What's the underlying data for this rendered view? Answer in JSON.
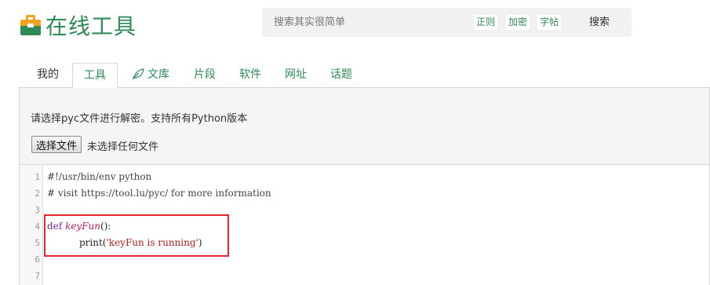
{
  "header": {
    "logo_text": "在线工具",
    "search_placeholder": "搜索其实很简单",
    "quick_links": [
      "正则",
      "加密",
      "字帖"
    ],
    "search_button": "搜索"
  },
  "tabs": [
    {
      "label": "我的",
      "active": false
    },
    {
      "label": "工具",
      "active": true
    },
    {
      "label": "文库",
      "active": false,
      "icon": "leaf-icon"
    },
    {
      "label": "片段",
      "active": false
    },
    {
      "label": "软件",
      "active": false
    },
    {
      "label": "网址",
      "active": false
    },
    {
      "label": "话题",
      "active": false
    }
  ],
  "panel": {
    "description": "请选择pyc文件进行解密。支持所有Python版本",
    "file_button": "选择文件",
    "file_status": "未选择任何文件"
  },
  "editor": {
    "line_numbers": [
      "1",
      "2",
      "3",
      "4",
      "5",
      "6",
      "7"
    ],
    "lines": {
      "l1": "#!/usr/bin/env python",
      "l2": "# visit https://tool.lu/pyc/ for more information",
      "l4_kw": "def",
      "l4_fn": "keyFun",
      "l4_rest": "():",
      "l5_call": "print(",
      "l5_str": "'keyFun is running'",
      "l5_close": ")"
    }
  },
  "colors": {
    "brand_green": "#2e8b57",
    "logo_orange": "#f0a41e",
    "highlight_red": "#e0282e"
  }
}
